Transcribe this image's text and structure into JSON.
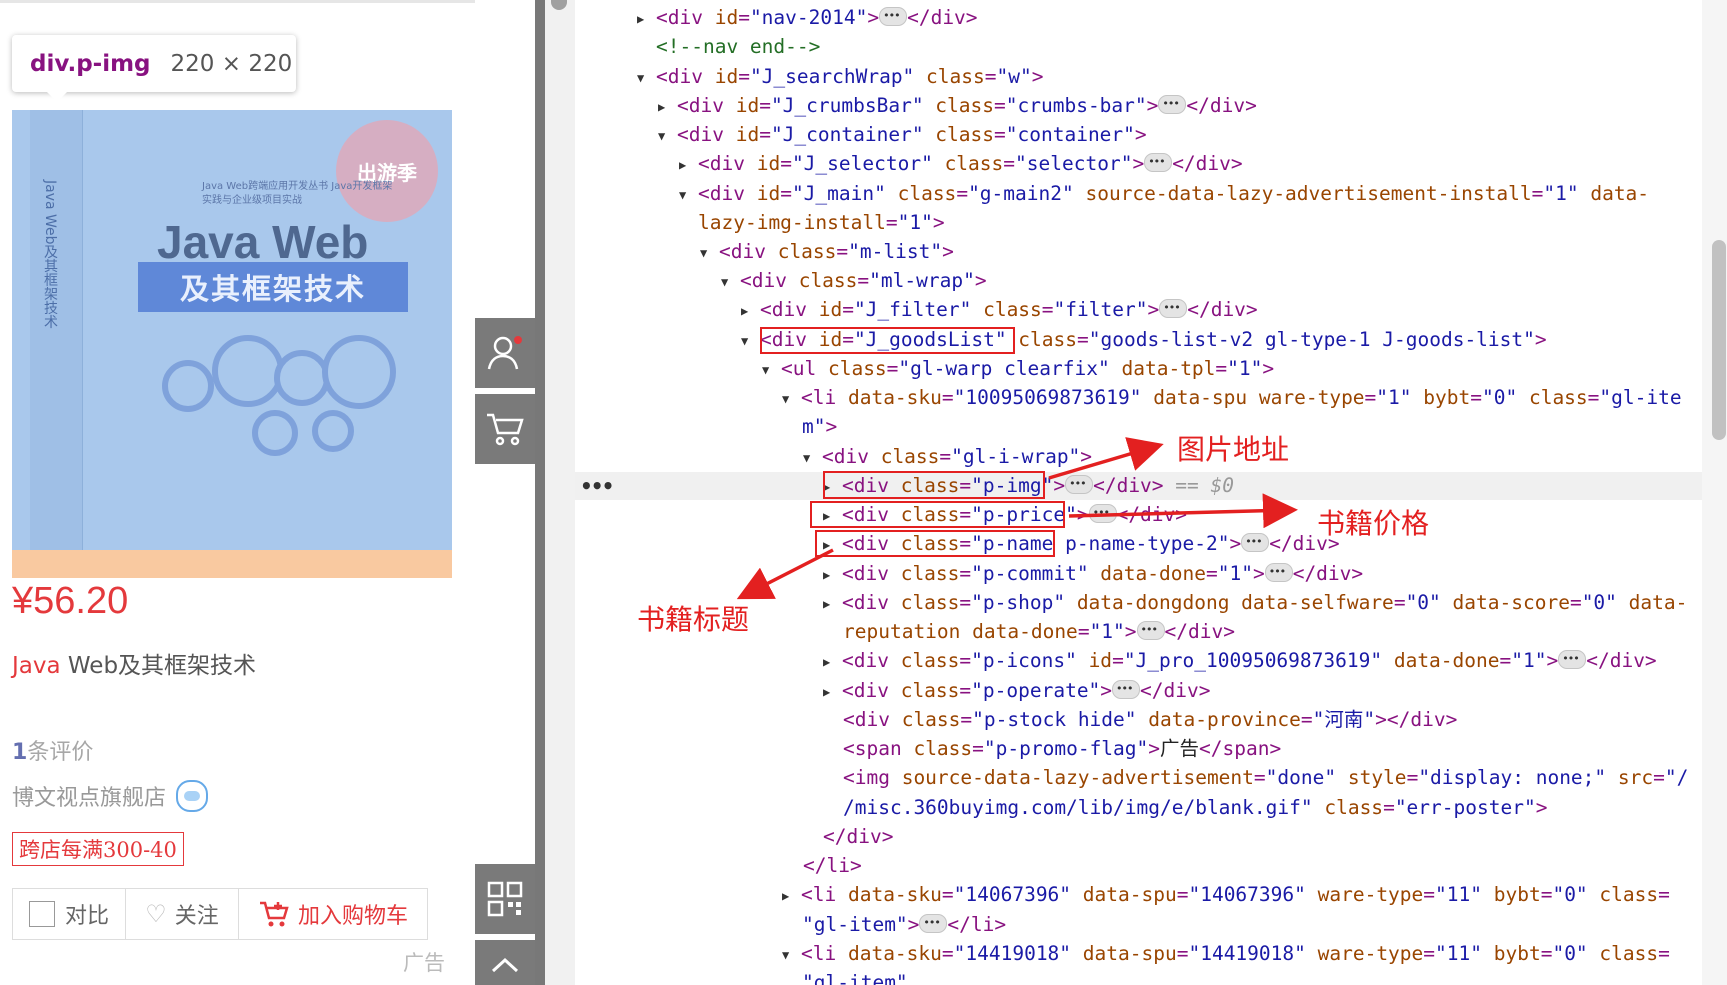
{
  "tooltip": {
    "selector": "div.p-img",
    "size": "220 × 220"
  },
  "product": {
    "cover_badge": "出游季",
    "cover_subtitle": "Java Web跨端应用开发丛书 Java开发框架实践与企业级项目实战",
    "cover_title": "Java Web",
    "cover_banner": "及其框架技术",
    "spine_text": "Java Web及其框架技术",
    "price": "¥56.20",
    "title_highlight": "Java",
    "title_rest": " Web及其框架技术",
    "reviews_count": "1",
    "reviews_label": "条评价",
    "shop": "博文视点旗舰店",
    "promo": "跨店每满300-40",
    "compare": "对比",
    "follow": "关注",
    "add_to_cart": "加入购物车",
    "ad": "广告"
  },
  "devtools": {
    "nav": {
      "open": "<div ",
      "attr": "id",
      "val": "\"nav-2014\"",
      "close": "</div>"
    },
    "comment": "<!--nav end-->",
    "search_wrap": {
      "tag": "<div ",
      "a1": "id",
      "v1": "\"J_searchWrap\"",
      "a2": " class",
      "v2": "\"w\""
    },
    "crumbs": {
      "tag": "<div ",
      "a1": "id",
      "v1": "\"J_crumbsBar\"",
      "a2": " class",
      "v2": "\"crumbs-bar\"",
      "close": "</div>"
    },
    "container": {
      "tag": "<div ",
      "a1": "id",
      "v1": "\"J_container\"",
      "a2": " class",
      "v2": "\"container\""
    },
    "selector": {
      "tag": "<div ",
      "a1": "id",
      "v1": "\"J_selector\"",
      "a2": " class",
      "v2": "\"selector\"",
      "close": "</div>"
    },
    "main": {
      "tag": "<div ",
      "a1": "id",
      "v1": "\"J_main\"",
      "a2": " class",
      "v2": "\"g-main2\"",
      "a3": " source-data-lazy-advertisement-install",
      "v3": "\"1\"",
      "a4": " data-",
      "a4b": "lazy-img-install",
      "v4": "\"1\""
    },
    "mlist": {
      "tag": "<div ",
      "a1": "class",
      "v1": "\"m-list\""
    },
    "mlwrap": {
      "tag": "<div ",
      "a1": "class",
      "v1": "\"ml-wrap\""
    },
    "filter": {
      "tag": "<div ",
      "a1": "id",
      "v1": "\"J_filter\"",
      "a2": " class",
      "v2": "\"filter\"",
      "close": "</div>"
    },
    "goodslist": {
      "tag": "<div ",
      "a1": "id",
      "v1": "\"J_goodsList\"",
      "a2": " class",
      "v2": "\"goods-list-v2 gl-type-1 J-goods-list\""
    },
    "ulwarp": {
      "tag": "<ul ",
      "a1": "class",
      "v1": "\"gl-warp clearfix\"",
      "a2": " data-tpl",
      "v2": "\"1\""
    },
    "li1": {
      "tag": "<li ",
      "a1": "data-sku",
      "v1": "\"10095069873619\"",
      "a2": " data-spu ware-type",
      "v2": "\"1\"",
      "a3": " bybt",
      "v3": "\"0\"",
      "a4": " class",
      "v4": "\"gl-ite",
      "v4b": "m\""
    },
    "gliwrap": {
      "tag": "<div ",
      "a1": "class",
      "v1": "\"gl-i-wrap\""
    },
    "pimg": {
      "tag": "<div ",
      "a1": "class",
      "v1": "\"p-img\"",
      "close": "</div>",
      "eq": " == $0"
    },
    "pprice": {
      "tag": "<div ",
      "a1": "class",
      "v1": "\"p-price\"",
      "close": "</div>"
    },
    "pname": {
      "tag": "<div ",
      "a1": "class",
      "v1": "\"p-name p-name-type-2\"",
      "close": "</div>"
    },
    "pcommit": {
      "tag": "<div ",
      "a1": "class",
      "v1": "\"p-commit\"",
      "a2": " data-done",
      "v2": "\"1\"",
      "close": "</div>"
    },
    "pshop": {
      "tag": "<div ",
      "a1": "class",
      "v1": "\"p-shop\"",
      "a2": " data-dongdong data-selfware",
      "v2": "\"0\"",
      "a3": " data-score",
      "v3": "\"0\"",
      "a4": " data-",
      "a4b": "reputation data-done",
      "v4": "\"1\"",
      "close": "</div>"
    },
    "picons": {
      "tag": "<div ",
      "a1": "class",
      "v1": "\"p-icons\"",
      "a2": " id",
      "v2": "\"J_pro_10095069873619\"",
      "a3": " data-done",
      "v3": "\"1\"",
      "close": "</div>"
    },
    "poperate": {
      "tag": "<div ",
      "a1": "class",
      "v1": "\"p-operate\"",
      "close": "</div>"
    },
    "pstock": {
      "tag": "<div ",
      "a1": "class",
      "v1": "\"p-stock hide\"",
      "a2": " data-province",
      "v2": "\"河南\"",
      "close": "</div>"
    },
    "promo_flag": {
      "tag": "<span ",
      "a1": "class",
      "v1": "\"p-promo-flag\"",
      "text": "广告",
      "close": "</span>"
    },
    "img": {
      "tag": "<img ",
      "a1": "source-data-lazy-advertisement",
      "v1": "\"done\"",
      "a2": " style",
      "v2": "\"display: none;\"",
      "a3": " src",
      "v3": "\"/",
      "v3b": "/misc.360buyimg.com/lib/img/e/blank.gif\"",
      "a4": " class",
      "v4": "\"err-poster\""
    },
    "close_div": "</div>",
    "close_li": "</li>",
    "li2": {
      "tag": "<li ",
      "a1": "data-sku",
      "v1": "\"14067396\"",
      "a2": " data-spu",
      "v2": "\"14067396\"",
      "a3": " ware-type",
      "v3": "\"11\"",
      "a4": " bybt",
      "v4": "\"0\"",
      "a5": " class",
      "v5": "\"",
      "v5b": "gl-item\"",
      "close": "</li>"
    },
    "li3": {
      "tag": "<li ",
      "a1": "data-sku",
      "v1": "\"14419018\"",
      "a2": " data-spu",
      "v2": "\"14419018\"",
      "a3": " ware-type",
      "v3": "\"11\"",
      "a4": " bybt",
      "v4": "\"0\"",
      "a5": " class",
      "v5": "\"",
      "v5b": "gl-item\""
    }
  },
  "annotations": {
    "image_url": "图片地址",
    "book_price": "书籍价格",
    "book_title": "书籍标题"
  }
}
